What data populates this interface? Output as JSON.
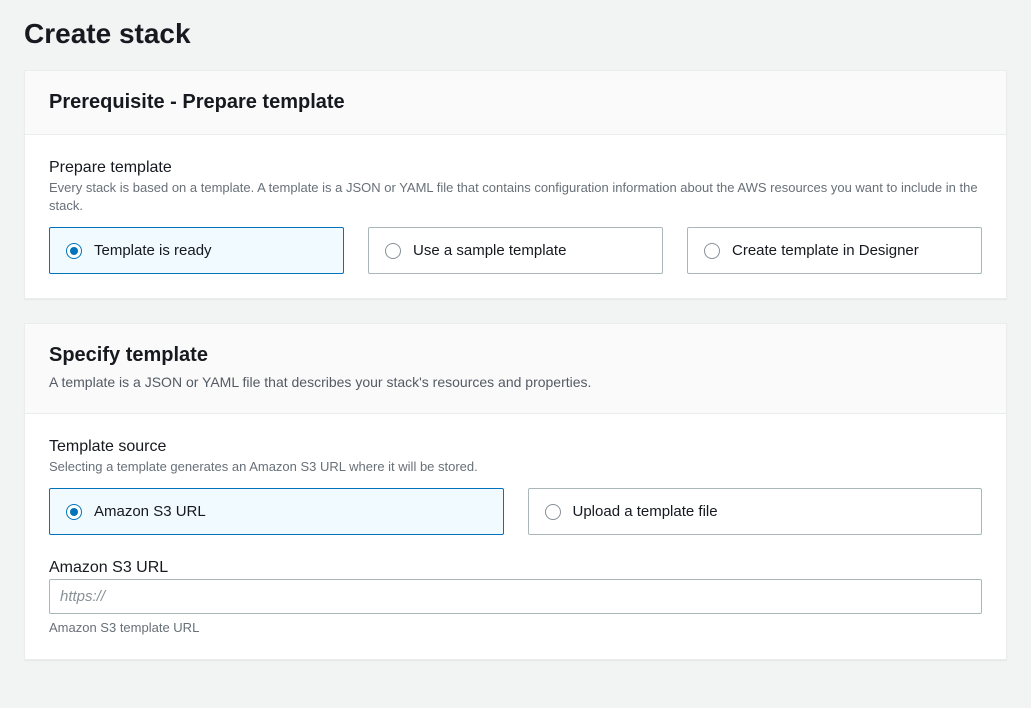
{
  "page": {
    "title": "Create stack"
  },
  "prerequisite": {
    "heading": "Prerequisite - Prepare template",
    "prepare": {
      "label": "Prepare template",
      "help": "Every stack is based on a template. A template is a JSON or YAML file that contains configuration information about the AWS resources you want to include in the stack.",
      "options": [
        {
          "label": "Template is ready",
          "selected": true
        },
        {
          "label": "Use a sample template",
          "selected": false
        },
        {
          "label": "Create template in Designer",
          "selected": false
        }
      ]
    }
  },
  "specify": {
    "heading": "Specify template",
    "subheading": "A template is a JSON or YAML file that describes your stack's resources and properties.",
    "source": {
      "label": "Template source",
      "help": "Selecting a template generates an Amazon S3 URL where it will be stored.",
      "options": [
        {
          "label": "Amazon S3 URL",
          "selected": true
        },
        {
          "label": "Upload a template file",
          "selected": false
        }
      ]
    },
    "s3url": {
      "label": "Amazon S3 URL",
      "placeholder": "https://",
      "value": "",
      "caption": "Amazon S3 template URL"
    }
  }
}
